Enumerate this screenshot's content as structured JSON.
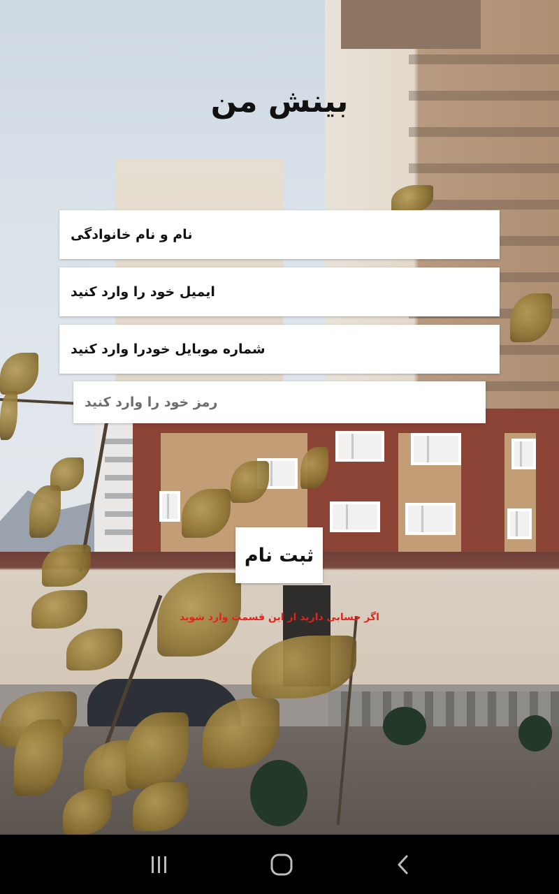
{
  "app": {
    "title": "بینش من"
  },
  "form": {
    "name_placeholder": "نام و نام خانوادگی",
    "email_placeholder": "ایمیل خود را وارد کنید",
    "mobile_placeholder": "شماره موبایل خودرا وارد کنید",
    "password_placeholder": "رمز خود را وارد کنید",
    "register_label": "ثبت نام",
    "login_prompt": "اگر حسابی دارید از این قسمت وارد شوید"
  },
  "colors": {
    "login_prompt": "#e0241f",
    "field_background": "#ffffff",
    "navbar_background": "#000000"
  },
  "navbar": {
    "icons": [
      "recent-apps-icon",
      "home-icon",
      "back-icon"
    ]
  }
}
